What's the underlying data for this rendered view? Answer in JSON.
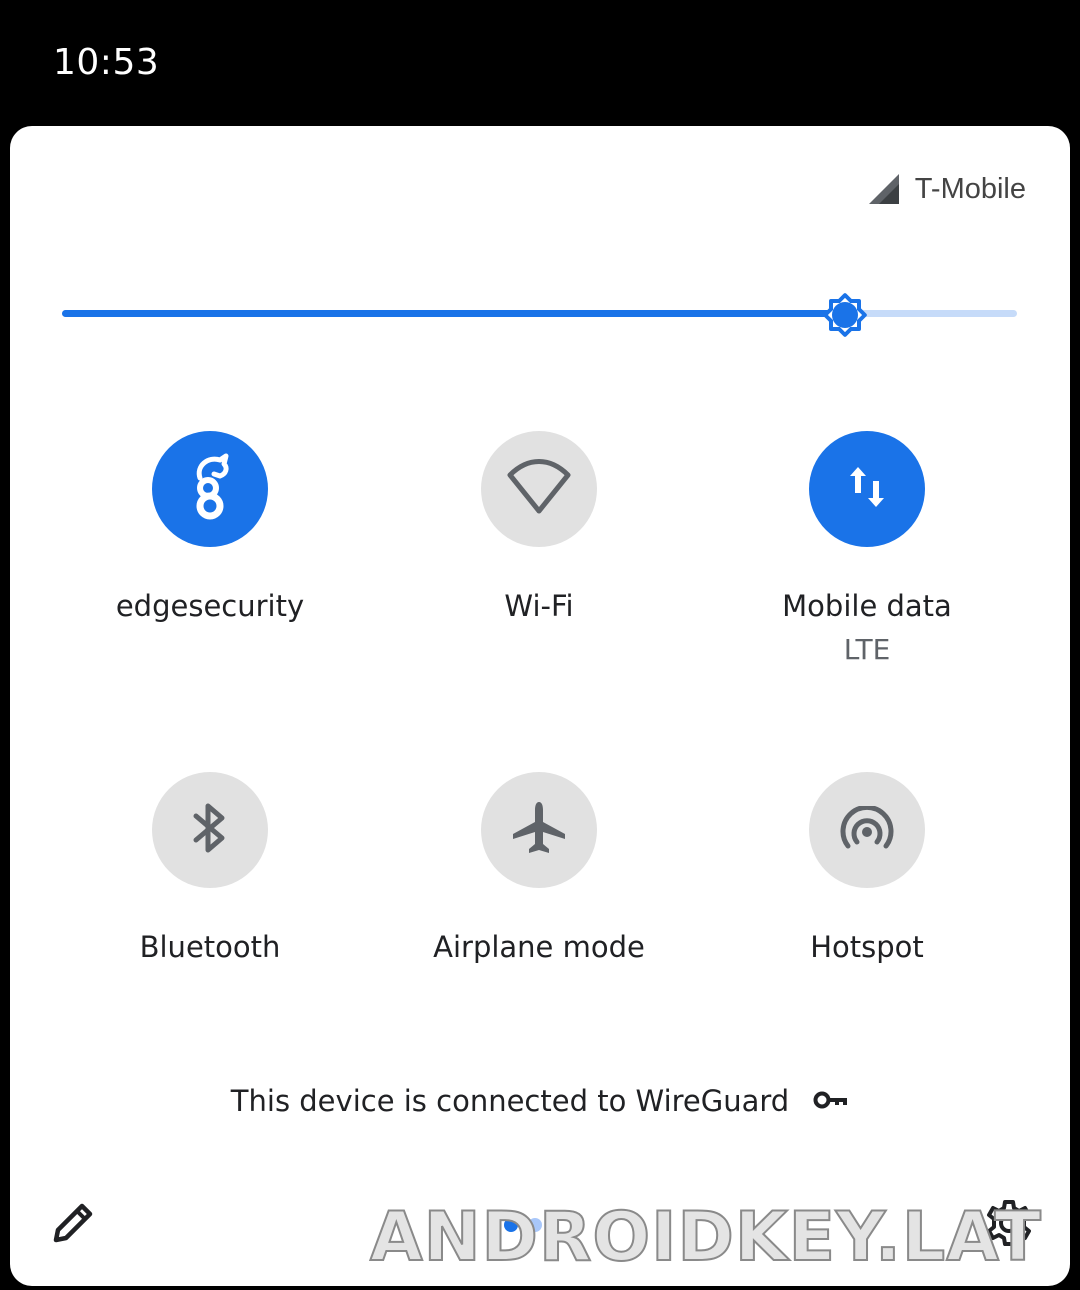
{
  "status_bar": {
    "time": "10:53"
  },
  "carrier": {
    "name": "T-Mobile",
    "icon": "signal-icon"
  },
  "brightness": {
    "level": 0.82,
    "icon": "brightness-icon"
  },
  "tiles": [
    {
      "label": "edgesecurity",
      "sublabel": "",
      "active": true,
      "icon": "wireguard-icon"
    },
    {
      "label": "Wi-Fi",
      "sublabel": "",
      "active": false,
      "icon": "wifi-icon"
    },
    {
      "label": "Mobile data",
      "sublabel": "LTE",
      "active": true,
      "icon": "mobile-data-icon"
    },
    {
      "label": "Bluetooth",
      "sublabel": "",
      "active": false,
      "icon": "bluetooth-icon"
    },
    {
      "label": "Airplane mode",
      "sublabel": "",
      "active": false,
      "icon": "airplane-icon"
    },
    {
      "label": "Hotspot",
      "sublabel": "",
      "active": false,
      "icon": "hotspot-icon"
    }
  ],
  "footer": {
    "vpn_message": "This device is connected to WireGuard",
    "vpn_icon": "key-icon",
    "edit_icon": "pencil-icon",
    "settings_icon": "gear-icon"
  },
  "watermark": {
    "text": "ANDROIDKEY.LAT"
  },
  "colors": {
    "accent": "#1a73e8",
    "tile_off": "#e1e1e1",
    "panel": "#ffffff",
    "background": "#000000"
  }
}
